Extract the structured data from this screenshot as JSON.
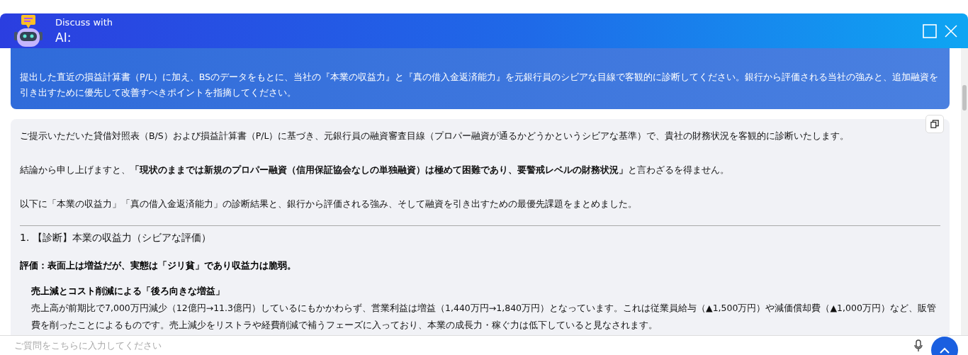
{
  "header": {
    "title_line1": "Discuss with",
    "title_line2": "AI:"
  },
  "user_message": {
    "text": "提出した直近の損益計算書（P/L）に加え、BSのデータをもとに、当社の『本業の収益力』と『真の借入金返済能力』を元銀行員のシビアな目線で客観的に診断してください。銀行から評価される当社の強みと、追加融資を引き出すために優先して改善すべきポイントを指摘してください。"
  },
  "response": {
    "blocks": [
      {
        "kind": "paragraph",
        "text": "ご提示いただいた貸借対照表（B/S）および損益計算書（P/L）に基づき、元銀行員の融資審査目線（プロパー融資が通るかどうかというシビアな基準）で、貴社の財務状況を客観的に診断いたします。"
      },
      {
        "kind": "paragraph",
        "text": "結論から申し上げますと、**「現状のままでは新規のプロパー融資（信用保証協会なしの単独融資）は極めて困難であり、要警戒レベルの財務状況」**と言わざるを得ません。"
      },
      {
        "kind": "paragraph",
        "text": "以下に「本業の収益力」「真の借入金返済能力」の診断結果と、銀行から評価される強み、そして融資を引き出すための最優先課題をまとめました。"
      },
      {
        "kind": "rule"
      },
      {
        "kind": "heading",
        "text": "1. 【診断】本業の収益力（シビアな評価）"
      },
      {
        "kind": "verdict",
        "text": "評価：表面上は増益だが、実態は「ジリ貧」であり収益力は脆弱。"
      },
      {
        "kind": "subheading",
        "text": "売上減とコスト削減による「後ろ向きな増益」"
      },
      {
        "kind": "detail",
        "text": "売上高が前期比で7,000万円減少（12億円→11.3億円）しているにもかかわらず、営業利益は増益（1,440万円→1,840万円）となっています。これは従業員給与（▲1,500万円）や減価償却費（▲1,000万円）など、販管費を削ったことによるものです。売上減少をリストラや経費削減で補うフェーズに入っており、本業の成長力・稼ぐ力は低下していると見なされます。"
      }
    ]
  },
  "input": {
    "placeholder": "ご質問をこちらに入力してください"
  }
}
